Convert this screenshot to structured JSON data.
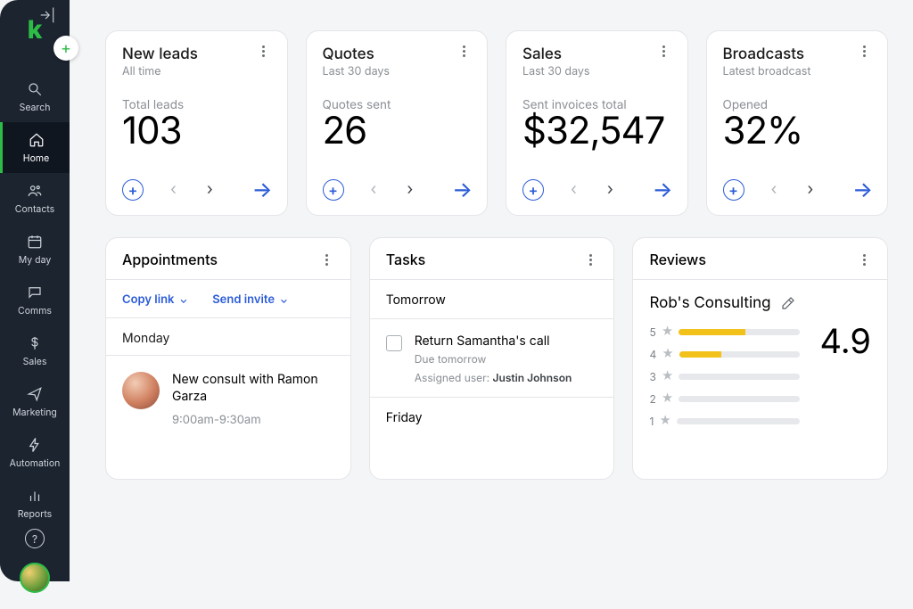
{
  "sidebar": {
    "items": [
      {
        "key": "search",
        "label": "Search"
      },
      {
        "key": "home",
        "label": "Home"
      },
      {
        "key": "contacts",
        "label": "Contacts"
      },
      {
        "key": "myday",
        "label": "My day"
      },
      {
        "key": "comms",
        "label": "Comms"
      },
      {
        "key": "sales",
        "label": "Sales"
      },
      {
        "key": "marketing",
        "label": "Marketing"
      },
      {
        "key": "automation",
        "label": "Automation"
      },
      {
        "key": "reports",
        "label": "Reports"
      }
    ]
  },
  "stats": [
    {
      "title": "New leads",
      "subtitle": "All time",
      "metric_label": "Total leads",
      "value": "103"
    },
    {
      "title": "Quotes",
      "subtitle": "Last 30 days",
      "metric_label": "Quotes sent",
      "value": "26"
    },
    {
      "title": "Sales",
      "subtitle": "Last 30 days",
      "metric_label": "Sent invoices total",
      "value": "$32,547"
    },
    {
      "title": "Broadcasts",
      "subtitle": "Latest broadcast",
      "metric_label": "Opened",
      "value": "32%"
    }
  ],
  "appointments": {
    "title": "Appointments",
    "actions": {
      "copy": "Copy link",
      "invite": "Send invite"
    },
    "day": "Monday",
    "item": {
      "title": "New consult with Ramon Garza",
      "time": "9:00am-9:30am"
    }
  },
  "tasks": {
    "title": "Tasks",
    "day1": "Tomorrow",
    "item": {
      "title": "Return Samantha's call",
      "due": "Due tomorrow",
      "assigned_label": "Assigned user:",
      "assigned_user": "Justin Johnson"
    },
    "day2": "Friday"
  },
  "reviews": {
    "title": "Reviews",
    "business": "Rob's Consulting",
    "score": "4.9",
    "bars": [
      {
        "label": "5",
        "pct": 55
      },
      {
        "label": "4",
        "pct": 35
      },
      {
        "label": "3",
        "pct": 0
      },
      {
        "label": "2",
        "pct": 0
      },
      {
        "label": "1",
        "pct": 0
      }
    ]
  }
}
